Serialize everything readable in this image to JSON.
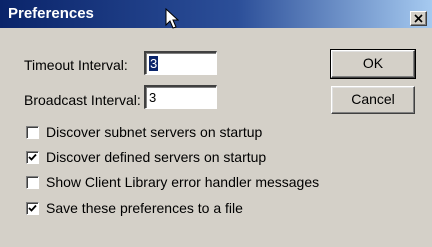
{
  "window": {
    "title": "Preferences",
    "close_glyph": "×",
    "close_icon": "close-icon",
    "title_gradient": [
      "#0a246a",
      "#a6caf0"
    ]
  },
  "fields": {
    "timeout": {
      "label": "Timeout Interval:",
      "value": "3"
    },
    "broadcast": {
      "label": "Broadcast Interval:",
      "value": "3"
    }
  },
  "buttons": {
    "ok": "OK",
    "cancel": "Cancel"
  },
  "checkboxes": [
    {
      "label": "Discover subnet servers on startup",
      "checked": false
    },
    {
      "label": "Discover defined servers on startup",
      "checked": true
    },
    {
      "label": "Show Client Library error handler messages",
      "checked": false
    },
    {
      "label": "Save these preferences to a file",
      "checked": true
    }
  ],
  "colors": {
    "face": "#d4d0c8",
    "title_bar": "#0a246a",
    "selection": "#0a246a"
  }
}
